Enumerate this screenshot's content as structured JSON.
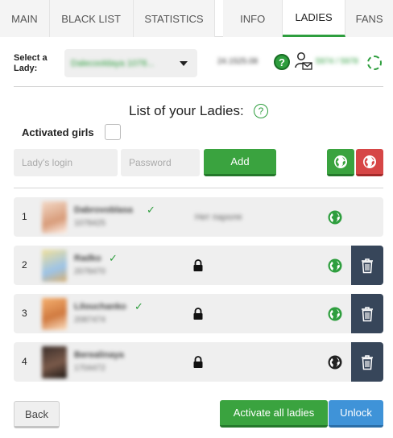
{
  "tabs": [
    "MAIN",
    "BLACK LIST",
    "STATISTICS",
    "INFO",
    "LADIES",
    "FANS"
  ],
  "active_tab": "LADIES",
  "lady_select": {
    "label_line1": "Select a",
    "label_line2": "Lady:",
    "value": "Dalecooldaya 1078..."
  },
  "stats": {
    "left": "24.1525.08",
    "right": "5974 / 5978"
  },
  "list": {
    "title": "List of your Ladies:",
    "help": "?",
    "activated_label": "Activated girls"
  },
  "form": {
    "login_placeholder": "Lady's login",
    "password_placeholder": "Password",
    "add_label": "Add"
  },
  "colors": {
    "accent_green": "#3aa33f",
    "danger_red": "#d64646",
    "info_blue": "#3f93d8",
    "dark_slate": "#37465a"
  },
  "ladies": [
    {
      "num": "1",
      "name": "Dabrovoblasa",
      "id": "1078425",
      "verified": true,
      "note": "Нет пароля",
      "locked": false,
      "online": true,
      "removable": false
    },
    {
      "num": "2",
      "name": "Radko",
      "id": "2078470",
      "verified": true,
      "note": "",
      "locked": true,
      "online": true,
      "removable": true
    },
    {
      "num": "3",
      "name": "Lilouchanko",
      "id": "2087474",
      "verified": true,
      "note": "",
      "locked": true,
      "online": true,
      "removable": true
    },
    {
      "num": "4",
      "name": "Berealinaya",
      "id": "1704472",
      "verified": false,
      "note": "",
      "locked": true,
      "online": false,
      "removable": true
    }
  ],
  "footer": {
    "back_label": "Back",
    "activate_all_label": "Activate all ladies",
    "unlock_label": "Unlock"
  }
}
